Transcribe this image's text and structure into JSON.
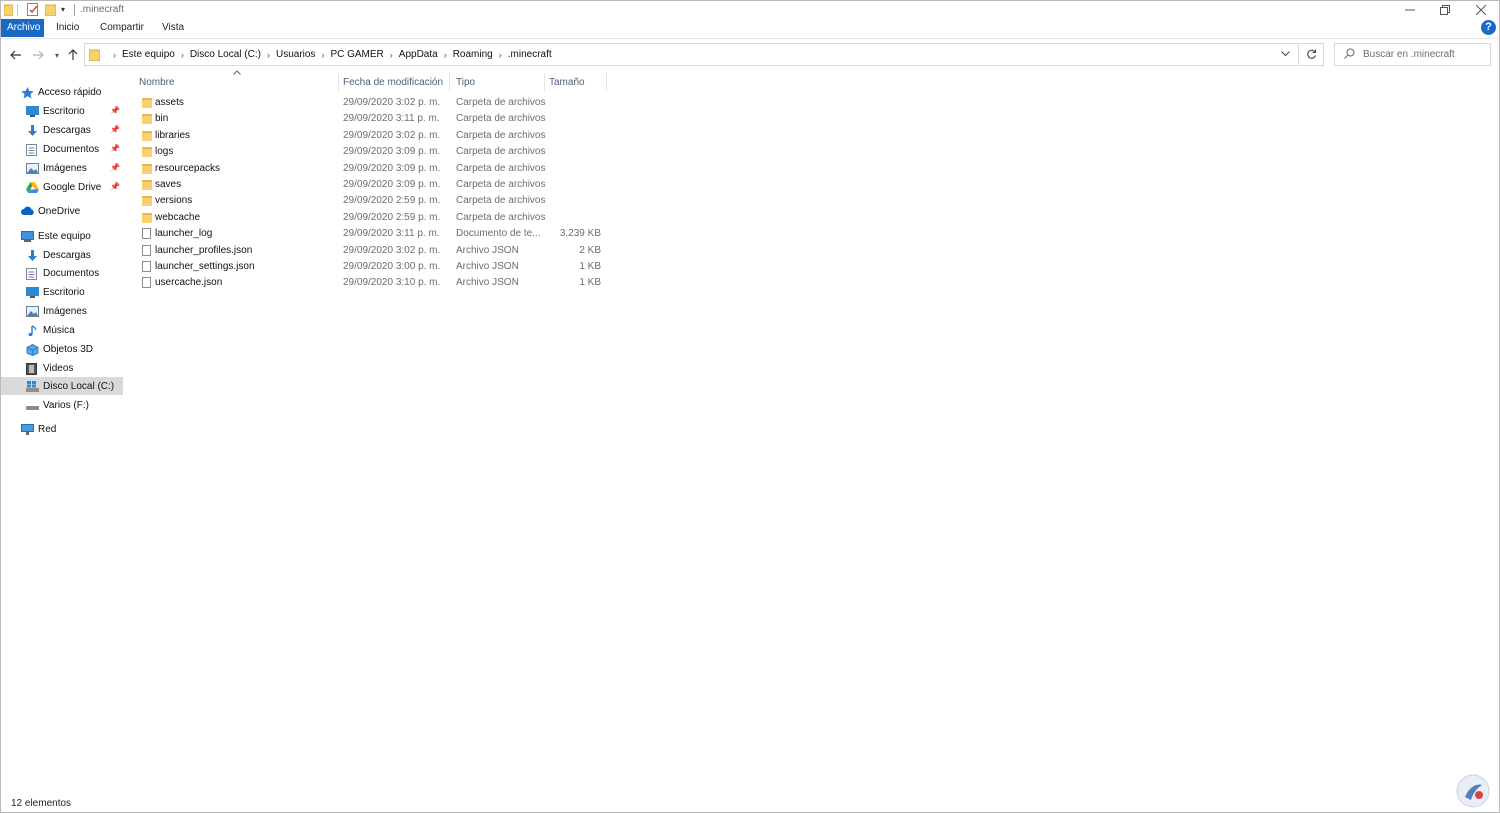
{
  "window": {
    "title": ".minecraft"
  },
  "ribbon": {
    "tabs": [
      "Archivo",
      "Inicio",
      "Compartir",
      "Vista"
    ],
    "help_label": "?"
  },
  "address": {
    "crumbs": [
      "Este equipo",
      "Disco Local (C:)",
      "Usuarios",
      "PC GAMER",
      "AppData",
      "Roaming",
      ".minecraft"
    ]
  },
  "search": {
    "placeholder": "Buscar en .minecraft"
  },
  "nav_pane": {
    "quick_access": "Acceso rápido",
    "quick_items": [
      "Escritorio",
      "Descargas",
      "Documentos",
      "Imágenes",
      "Google Drive"
    ],
    "onedrive": "OneDrive",
    "this_pc": "Este equipo",
    "pc_items": [
      "Descargas",
      "Documentos",
      "Escritorio",
      "Imágenes",
      "Música",
      "Objetos 3D",
      "Videos",
      "Disco Local (C:)",
      "Varios (F:)"
    ],
    "network": "Red"
  },
  "columns": {
    "name": "Nombre",
    "date": "Fecha de modificación",
    "type": "Tipo",
    "size": "Tamaño"
  },
  "files": [
    {
      "name": "assets",
      "date": "29/09/2020 3:02 p. m.",
      "type": "Carpeta de archivos",
      "size": "",
      "kind": "folder"
    },
    {
      "name": "bin",
      "date": "29/09/2020 3:11 p. m.",
      "type": "Carpeta de archivos",
      "size": "",
      "kind": "folder"
    },
    {
      "name": "libraries",
      "date": "29/09/2020 3:02 p. m.",
      "type": "Carpeta de archivos",
      "size": "",
      "kind": "folder"
    },
    {
      "name": "logs",
      "date": "29/09/2020 3:09 p. m.",
      "type": "Carpeta de archivos",
      "size": "",
      "kind": "folder"
    },
    {
      "name": "resourcepacks",
      "date": "29/09/2020 3:09 p. m.",
      "type": "Carpeta de archivos",
      "size": "",
      "kind": "folder"
    },
    {
      "name": "saves",
      "date": "29/09/2020 3:09 p. m.",
      "type": "Carpeta de archivos",
      "size": "",
      "kind": "folder"
    },
    {
      "name": "versions",
      "date": "29/09/2020 2:59 p. m.",
      "type": "Carpeta de archivos",
      "size": "",
      "kind": "folder"
    },
    {
      "name": "webcache",
      "date": "29/09/2020 2:59 p. m.",
      "type": "Carpeta de archivos",
      "size": "",
      "kind": "folder"
    },
    {
      "name": "launcher_log",
      "date": "29/09/2020 3:11 p. m.",
      "type": "Documento de te...",
      "size": "3.239 KB",
      "kind": "file"
    },
    {
      "name": "launcher_profiles.json",
      "date": "29/09/2020 3:02 p. m.",
      "type": "Archivo JSON",
      "size": "2 KB",
      "kind": "file"
    },
    {
      "name": "launcher_settings.json",
      "date": "29/09/2020 3:00 p. m.",
      "type": "Archivo JSON",
      "size": "1 KB",
      "kind": "file"
    },
    {
      "name": "usercache.json",
      "date": "29/09/2020 3:10 p. m.",
      "type": "Archivo JSON",
      "size": "1 KB",
      "kind": "file"
    }
  ],
  "status": {
    "count": "12 elementos"
  },
  "colors": {
    "accent": "#1a69c5",
    "folder": "#f7d16a",
    "selection": "#d9d9d9"
  }
}
